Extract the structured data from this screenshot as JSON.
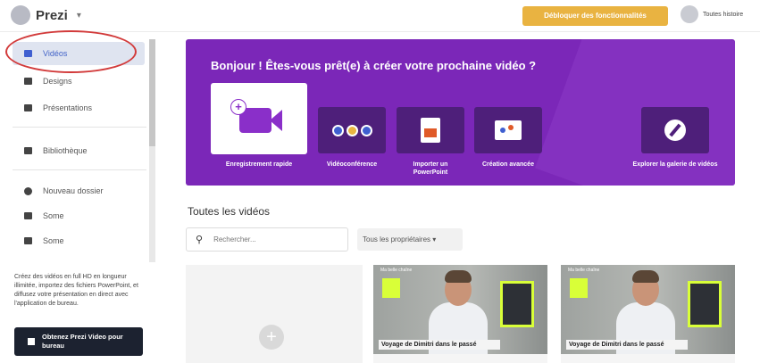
{
  "app": {
    "name": "Prezi",
    "unlock_label": "Débloquer des fonctionnalités",
    "user_name": "Toutes histoire"
  },
  "sidebar": {
    "items": [
      {
        "label": "Vidéos",
        "icon": "video-icon",
        "active": true
      },
      {
        "label": "Designs",
        "icon": "designs-icon"
      },
      {
        "label": "Présentations",
        "icon": "presentation-icon"
      },
      {
        "label": "Bibliothèque",
        "icon": "library-icon"
      },
      {
        "label": "Nouveau dossier",
        "icon": "add-folder-icon"
      },
      {
        "label": "Some",
        "icon": "folder-icon"
      },
      {
        "label": "Some",
        "icon": "folder-icon"
      }
    ],
    "promo_text": "Créez des vidéos en full HD en longueur illimitée, importez des fichiers PowerPoint, et diffusez votre présentation en direct avec l'application de bureau.",
    "promo_button": "Obtenez Prezi Video pour bureau"
  },
  "banner": {
    "title": "Bonjour ! Êtes-vous prêt(e) à créer votre prochaine vidéo ?",
    "cards": [
      {
        "label": "Enregistrement rapide",
        "icon": "video-camera-icon"
      },
      {
        "label": "Vidéoconférence",
        "icon": "conference-icon"
      },
      {
        "label": "Importer un PowerPoint",
        "icon": "powerpoint-icon"
      },
      {
        "label": "Création avancée",
        "icon": "advanced-creation-icon"
      },
      {
        "label": "Explorer la galerie de vidéos",
        "icon": "compass-icon"
      }
    ],
    "color": "#7b27b8"
  },
  "main": {
    "section_title": "Toutes les vidéos",
    "search_placeholder": "Rechercher...",
    "owner_filter": "Tous les propriétaires",
    "videos": [
      {
        "caption": "Voyage de Dimitri dans le passé",
        "tag": "Ma belle chaîne"
      },
      {
        "caption": "Voyage de Dimitri dans le passé",
        "tag": "Ma belle chaîne"
      }
    ]
  }
}
